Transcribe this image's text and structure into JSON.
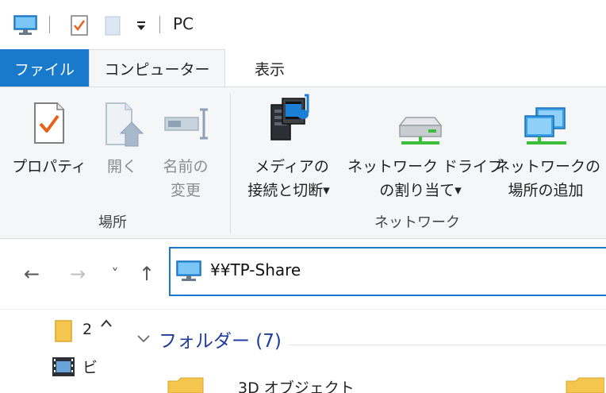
{
  "window": {
    "title": "PC"
  },
  "quick_access": {
    "icons": [
      "computer-icon",
      "properties-icon",
      "new-folder-icon",
      "customize-dropdown-icon"
    ]
  },
  "tabs": [
    {
      "label": "ファイル",
      "active": false
    },
    {
      "label": "コンピューター",
      "active": true
    },
    {
      "label": "表示",
      "active": false
    }
  ],
  "ribbon": {
    "groups": [
      {
        "label": "場所",
        "buttons": [
          {
            "line1": "プロパティ",
            "line2": "",
            "enabled": true,
            "icon": "properties-icon"
          },
          {
            "line1": "開く",
            "line2": "",
            "enabled": false,
            "icon": "open-icon"
          },
          {
            "line1": "名前の",
            "line2": "変更",
            "enabled": false,
            "icon": "rename-icon"
          }
        ]
      },
      {
        "label": "ネットワーク",
        "buttons": [
          {
            "line1": "メディアの",
            "line2": "接続と切断",
            "enabled": true,
            "icon": "media-server-icon",
            "dropdown": true
          },
          {
            "line1": "ネットワーク ドライブ",
            "line2": "の割り当て",
            "enabled": true,
            "icon": "network-drive-icon",
            "dropdown": true
          },
          {
            "line1": "ネットワークの",
            "line2": "場所の追加",
            "enabled": true,
            "icon": "network-location-icon"
          }
        ]
      }
    ]
  },
  "navigation": {
    "back": "←",
    "forward": "→",
    "recent": "˅",
    "up": "↑"
  },
  "address": {
    "value": "¥¥TP-Share",
    "icon": "computer-icon"
  },
  "nav_pane": {
    "items": [
      {
        "text": "2",
        "icon": "folder-icon"
      },
      {
        "text": "ビ",
        "icon": "video-folder-icon"
      }
    ]
  },
  "content": {
    "section_title": "フォルダー (7)",
    "items": [
      {
        "label": "3D オブジェクト"
      }
    ]
  },
  "colors": {
    "accent": "#1979ca",
    "ribbon_bg": "#f5f6f7",
    "section_header": "#1e3e9a"
  }
}
